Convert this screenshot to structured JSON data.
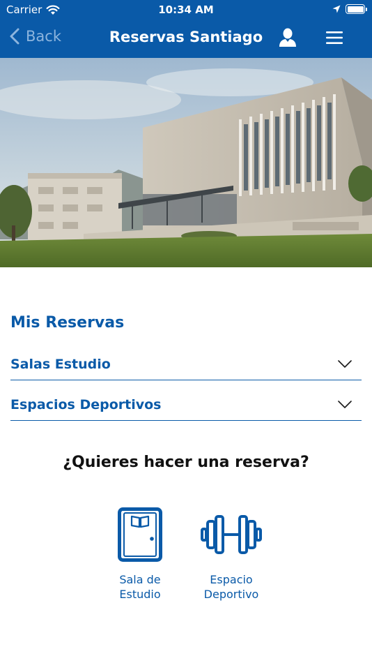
{
  "status_bar": {
    "carrier": "Carrier",
    "time": "10:34 AM",
    "wifi_icon": "wifi-icon",
    "location_icon": "location-arrow-icon",
    "battery_icon": "battery-full-icon"
  },
  "nav": {
    "back_label": "Back",
    "title": "Reservas Santiago",
    "profile_icon": "user-icon",
    "menu_icon": "hamburger-menu-icon"
  },
  "hero": {
    "image": "campus building photo"
  },
  "mis_reservas": {
    "title": "Mis Reservas",
    "items": [
      {
        "label": "Salas Estudio",
        "icon": "chevron-down-icon"
      },
      {
        "label": "Espacios Deportivos",
        "icon": "chevron-down-icon"
      }
    ]
  },
  "booking": {
    "prompt": "¿Quieres hacer una reserva?",
    "options": [
      {
        "label": "Sala de\nEstudio",
        "icon": "study-room-door-icon"
      },
      {
        "label": "Espacio\nDeportivo",
        "icon": "dumbbell-icon"
      }
    ]
  },
  "colors": {
    "brand_blue": "#0a5aa8",
    "back_text": "#8db5de",
    "prompt_text": "#111111",
    "background": "#ffffff"
  }
}
